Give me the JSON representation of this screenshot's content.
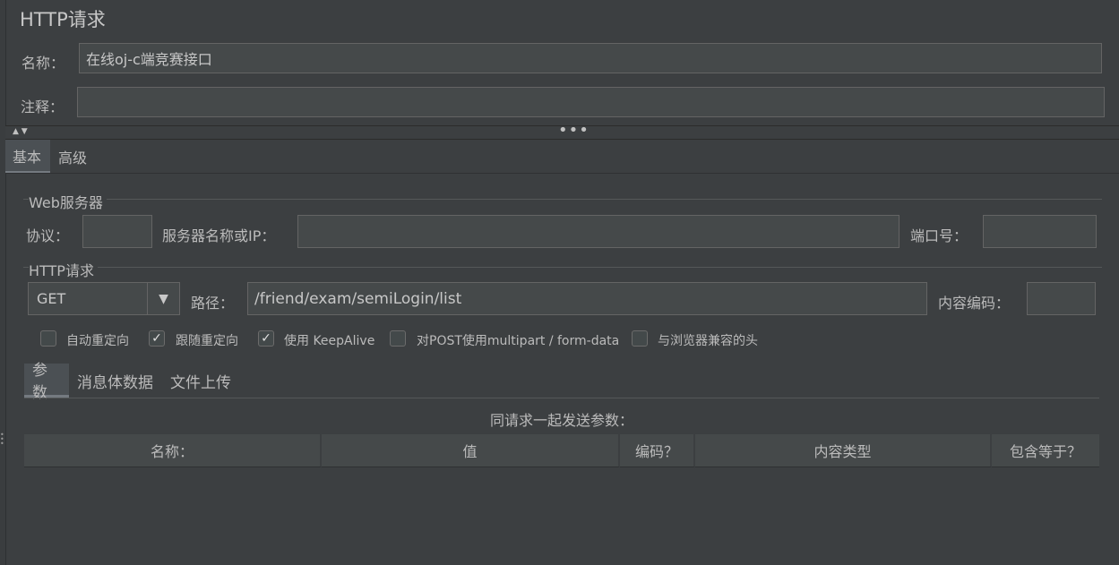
{
  "window": {
    "title": "HTTP请求"
  },
  "name_row": {
    "label": "名称：",
    "value": "在线oj-c端竞赛接口"
  },
  "comment_row": {
    "label": "注释：",
    "value": ""
  },
  "splitter": {
    "collapse_icons": "▲ ▼",
    "dots": "•••"
  },
  "main_tabs": [
    {
      "label": "基本",
      "selected": true
    },
    {
      "label": "高级",
      "selected": false
    }
  ],
  "web_server": {
    "group_title": "Web服务器",
    "protocol_label": "协议：",
    "protocol_value": "",
    "server_label": "服务器名称或IP：",
    "server_value": "",
    "port_label": "端口号：",
    "port_value": ""
  },
  "http_request": {
    "group_title": "HTTP请求",
    "method": "GET",
    "path_label": "路径：",
    "path_value": "/friend/exam/semiLogin/list",
    "encoding_label": "内容编码：",
    "encoding_value": ""
  },
  "options": [
    {
      "label": "自动重定向",
      "checked": false
    },
    {
      "label": "跟随重定向",
      "checked": true
    },
    {
      "label": "使用 KeepAlive",
      "checked": true
    },
    {
      "label": "对POST使用multipart / form-data",
      "checked": false
    },
    {
      "label": "与浏览器兼容的头",
      "checked": false
    }
  ],
  "sub_tabs": [
    {
      "label": "参数",
      "selected": true
    },
    {
      "label": "消息体数据",
      "selected": false
    },
    {
      "label": "文件上传",
      "selected": false
    }
  ],
  "params": {
    "caption": "同请求一起发送参数：",
    "columns": [
      "名称：",
      "值",
      "编码？",
      "内容类型",
      "包含等于？"
    ]
  },
  "colors": {
    "background": "#3c3f41",
    "field": "#45494a",
    "border": "#646464",
    "text": "#bbbbbb"
  },
  "icons": {
    "combo_arrow": "triangle-down-icon",
    "checkbox_mark": "check-icon"
  }
}
